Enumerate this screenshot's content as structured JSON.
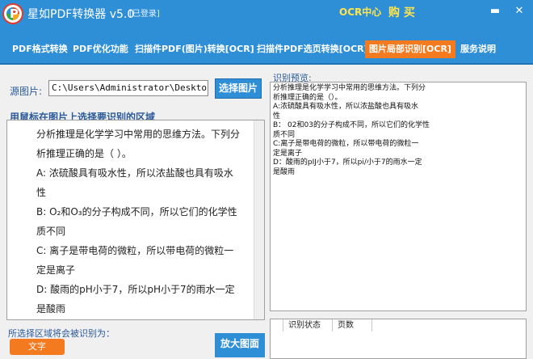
{
  "app": {
    "title": "星如PDF转换器 v5.0",
    "login_state": "[已登录]",
    "ocr_center": "OCR中心",
    "buy": "购 买",
    "logo_letter": "P"
  },
  "window": {
    "min_icon": "minimize-icon",
    "close_icon": "close-icon",
    "min_glyph": "▬",
    "close_glyph": "✕"
  },
  "menu": {
    "items": [
      {
        "label": "PDF格式转换"
      },
      {
        "label": "PDF优化功能"
      },
      {
        "label": "扫描件PDF(图片)转换[OCR]"
      },
      {
        "label": "扫描件PDF选页转换[OCR]"
      },
      {
        "label": "图片局部识别[OCR]",
        "active": true
      },
      {
        "label": "服务说明"
      }
    ]
  },
  "source": {
    "label": "源图片:",
    "path": "C:\\Users\\Administrator\\Desktop\\",
    "select_button": "选择图片"
  },
  "hint": "用鼠标在图片上选择要识别的区域",
  "image_content": {
    "lines": [
      "分析推理是化学学习中常用的思维方法。下列分",
      "析推理正确的是（ ）。",
      "A: 浓硫酸具有吸水性，所以浓盐酸也具有吸水",
      "性",
      "B: O₂和O₃的分子构成不同，所以它们的化学性",
      "质不同",
      "C: 离子是带电荷的微粒，所以带电荷的微粒一",
      "定是离子",
      "D: 酸雨的pH小于7，所以pH小于7的雨水一定",
      "是酸雨"
    ]
  },
  "bottom": {
    "result_label": "所选择区域将会被识别为：",
    "copy_button": "文字",
    "big_button": "放大图面"
  },
  "preview": {
    "label": "识别预览:",
    "text": "分析推理是化学学习中常用的思维方法。下列分\n析推理正确的是（）。\nA:浓硫酸具有吸水性，所以浓盐酸也具有吸水\n性\nB： 02和03的分子构成不同，所以它们的化学性\n质不同\nC:离子是带电荷的微粒，所以带电荷的微粒一\n定是离子\nD：酸雨的pIJ小于7，所以pi/小于7的雨水一定\n是酸雨"
  },
  "status_table": {
    "columns": [
      "",
      "识别状态",
      "页数"
    ]
  },
  "colors": {
    "primary": "#2e8fd6",
    "accent": "#f47a20",
    "highlight": "#ffe44d"
  }
}
